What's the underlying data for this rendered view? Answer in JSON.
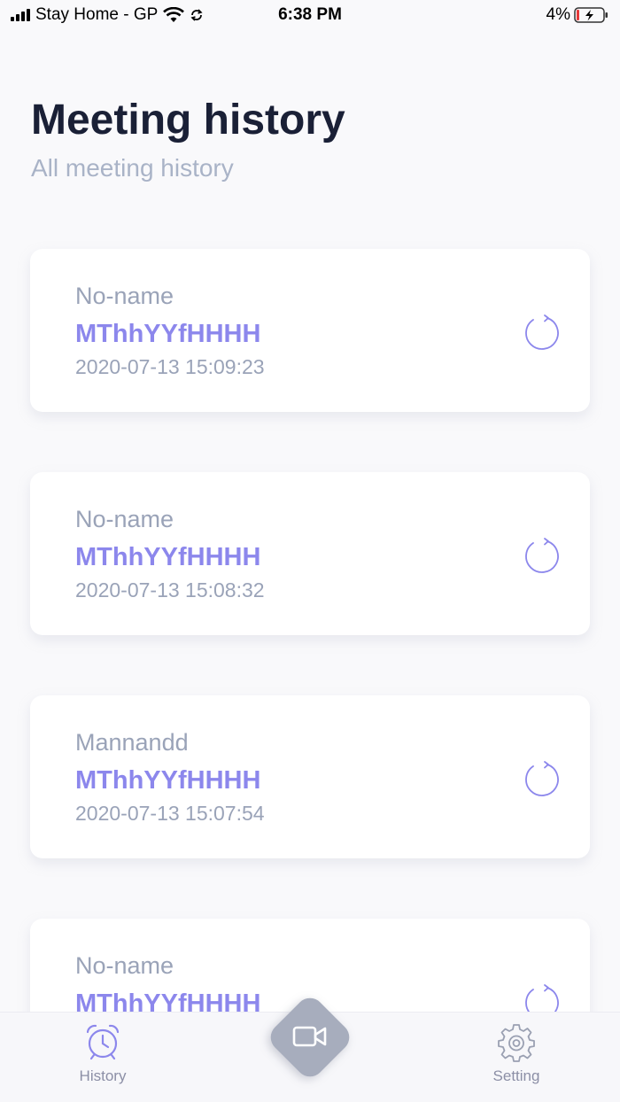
{
  "status_bar": {
    "carrier": "Stay Home - GP",
    "time": "6:38 PM",
    "battery": "4%"
  },
  "header": {
    "title": "Meeting history",
    "subtitle": "All meeting history"
  },
  "meetings": [
    {
      "name": "No-name",
      "code": "MThhYYfHHHH",
      "time": "2020-07-13 15:09:23"
    },
    {
      "name": "No-name",
      "code": "MThhYYfHHHH",
      "time": "2020-07-13 15:08:32"
    },
    {
      "name": "Mannandd",
      "code": "MThhYYfHHHH",
      "time": "2020-07-13 15:07:54"
    },
    {
      "name": "No-name",
      "code": "MThhYYfHHHH",
      "time": ""
    }
  ],
  "tab_bar": {
    "history_label": "History",
    "setting_label": "Setting",
    "active_tab": "history"
  },
  "colors": {
    "accent": "#8c87ec",
    "title": "#1a2036",
    "muted": "#9aa3b8",
    "fab": "#a7adbd"
  },
  "icons": {
    "history": "alarm-clock-icon",
    "record": "video-camera-icon",
    "setting": "gear-icon",
    "refresh": "refresh-icon"
  }
}
